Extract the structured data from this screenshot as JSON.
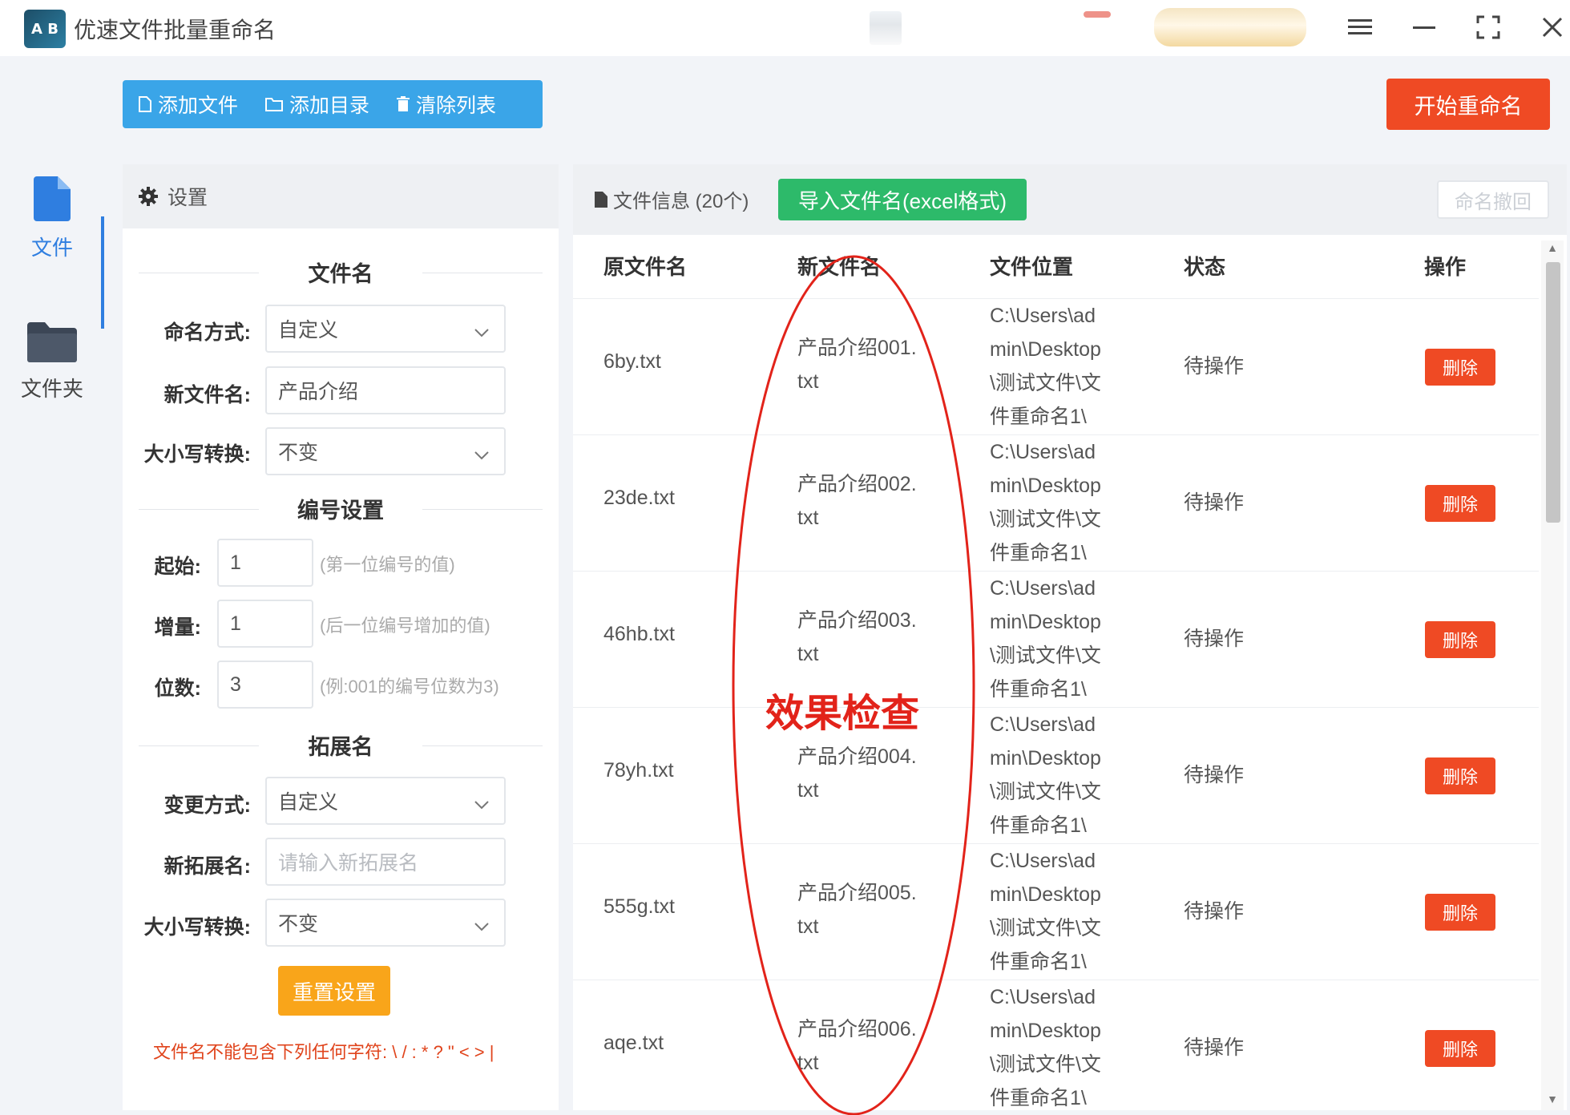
{
  "app": {
    "logo_text": "A B",
    "title": "优速文件批量重命名"
  },
  "nav": [
    {
      "label": "文件",
      "icon": "file-icon",
      "active": true
    },
    {
      "label": "文件夹",
      "icon": "folder-icon",
      "active": false
    }
  ],
  "toolbar": {
    "add_file": "添加文件",
    "add_dir": "添加目录",
    "clear_list": "清除列表",
    "start": "开始重命名"
  },
  "settings": {
    "header": "设置",
    "filename_section": "文件名",
    "naming_label": "命名方式:",
    "naming_value": "自定义",
    "newname_label": "新文件名:",
    "newname_value": "产品介绍",
    "case_label": "大小写转换:",
    "case_value": "不变",
    "number_section": "编号设置",
    "start_label": "起始:",
    "start_value": "1",
    "start_hint": "(第一位编号的值)",
    "step_label": "增量:",
    "step_value": "1",
    "step_hint": "(后一位编号增加的值)",
    "digits_label": "位数:",
    "digits_value": "3",
    "digits_hint": "(例:001的编号位数为3)",
    "ext_section": "拓展名",
    "ext_mode_label": "变更方式:",
    "ext_mode_value": "自定义",
    "ext_new_label": "新拓展名:",
    "ext_new_placeholder": "请输入新拓展名",
    "ext_case_label": "大小写转换:",
    "ext_case_value": "不变",
    "reset": "重置设置",
    "warning": "文件名不能包含下列任何字符: \\ / : * ? \" < > |"
  },
  "files": {
    "title": "文件信息 (20个)",
    "import": "导入文件名(excel格式)",
    "undo": "命名撤回",
    "columns": [
      "原文件名",
      "新文件名",
      "文件位置",
      "状态",
      "操作"
    ],
    "rows": [
      {
        "orig": "6by.txt",
        "new1": "产品介绍001.",
        "new2": "txt",
        "path": [
          "C:\\Users\\ad",
          "min\\Desktop",
          "\\测试文件\\文",
          "件重命名1\\"
        ],
        "status": "待操作",
        "action": "删除"
      },
      {
        "orig": "23de.txt",
        "new1": "产品介绍002.",
        "new2": "txt",
        "path": [
          "C:\\Users\\ad",
          "min\\Desktop",
          "\\测试文件\\文",
          "件重命名1\\"
        ],
        "status": "待操作",
        "action": "删除"
      },
      {
        "orig": "46hb.txt",
        "new1": "产品介绍003.",
        "new2": "txt",
        "path": [
          "C:\\Users\\ad",
          "min\\Desktop",
          "\\测试文件\\文",
          "件重命名1\\"
        ],
        "status": "待操作",
        "action": "删除"
      },
      {
        "orig": "78yh.txt",
        "new1": "产品介绍004.",
        "new2": "txt",
        "path": [
          "C:\\Users\\ad",
          "min\\Desktop",
          "\\测试文件\\文",
          "件重命名1\\"
        ],
        "status": "待操作",
        "action": "删除"
      },
      {
        "orig": "555g.txt",
        "new1": "产品介绍005.",
        "new2": "txt",
        "path": [
          "C:\\Users\\ad",
          "min\\Desktop",
          "\\测试文件\\文",
          "件重命名1\\"
        ],
        "status": "待操作",
        "action": "删除"
      },
      {
        "orig": "aqe.txt",
        "new1": "产品介绍006.",
        "new2": "txt",
        "path": [
          "C:\\Users\\ad",
          "min\\Desktop",
          "\\测试文件\\文",
          "件重命名1\\"
        ],
        "status": "待操作",
        "action": "删除"
      }
    ]
  },
  "annotation": {
    "text": "效果检查",
    "color": "#e2231a"
  },
  "colors": {
    "toolbar_blue": "#3aa5e8",
    "start_red": "#ef4a24",
    "import_green": "#2dba6a",
    "reset_orange": "#f9a51a",
    "nav_blue": "#2f7ee0"
  }
}
